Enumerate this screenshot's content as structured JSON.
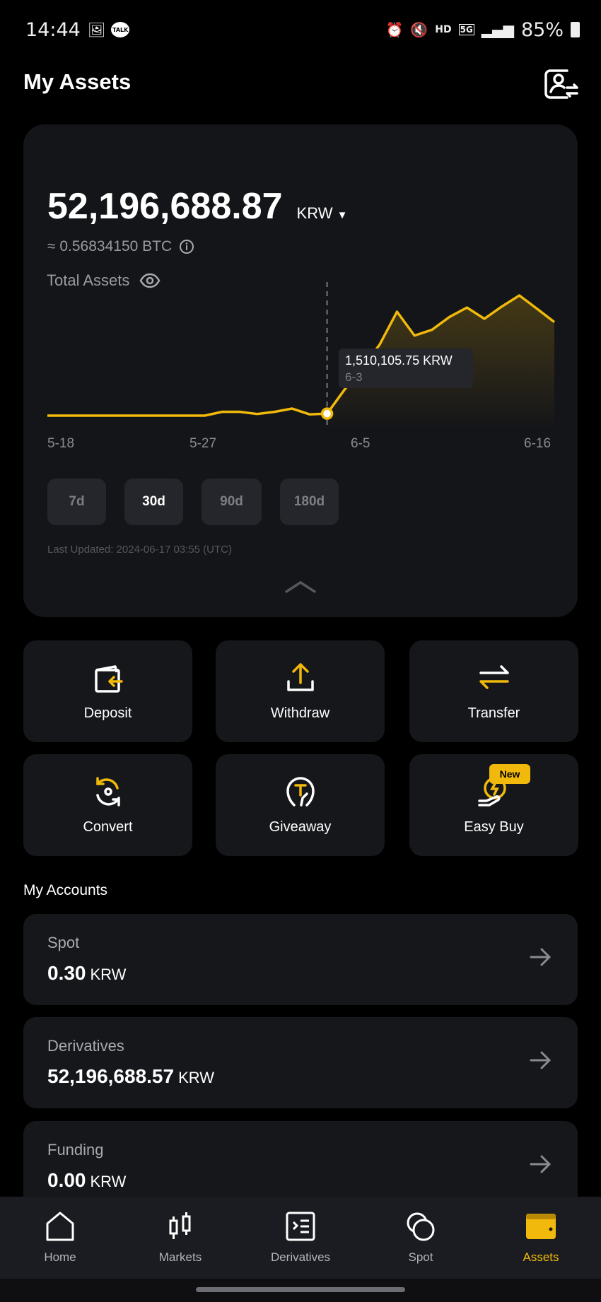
{
  "status_bar": {
    "time": "14:44",
    "battery": "85%",
    "icons": [
      "gallery-icon",
      "kakaotalk-icon",
      "alarm-icon",
      "mute-icon",
      "hd-voice-icon",
      "5g-icon",
      "signal-icon",
      "battery-icon"
    ],
    "hd": "HD",
    "fiveg": "5G",
    "talk": "TALK"
  },
  "header": {
    "title": "My Assets",
    "action_icon": "account-switch-icon"
  },
  "total": {
    "label": "Total Assets",
    "amount": "52,196,688.87",
    "currency": "KRW",
    "btc": "≈ 0.56834150 BTC"
  },
  "chart_data": {
    "type": "area",
    "x": [
      "5-18",
      "5-19",
      "5-20",
      "5-21",
      "5-22",
      "5-23",
      "5-24",
      "5-25",
      "5-26",
      "5-27",
      "5-28",
      "5-29",
      "5-30",
      "5-31",
      "6-1",
      "6-2",
      "6-3",
      "6-4",
      "6-5",
      "6-6",
      "6-7",
      "6-8",
      "6-9",
      "6-10",
      "6-11",
      "6-12",
      "6-13",
      "6-14",
      "6-15",
      "6-16"
    ],
    "values": [
      0.4,
      0.4,
      0.4,
      0.4,
      0.4,
      0.4,
      0.4,
      0.4,
      0.4,
      0.4,
      2.5,
      2.5,
      1.3,
      2.5,
      4.3,
      1.1,
      1.51,
      14.8,
      26.7,
      39.6,
      57.9,
      44.7,
      47.9,
      55.0,
      60.2,
      54.0,
      60.8,
      66.9,
      59.6,
      52.2
    ],
    "unit": "million KRW (estimated)",
    "x_tick_labels": [
      "5-18",
      "5-27",
      "6-5",
      "6-16"
    ],
    "tooltip": {
      "value": "1,510,105.75 KRW",
      "date": "6-3",
      "index": 16
    },
    "color": "#f0b90b",
    "grid": false
  },
  "ranges": [
    {
      "label": "7d",
      "active": false
    },
    {
      "label": "30d",
      "active": true
    },
    {
      "label": "90d",
      "active": false
    },
    {
      "label": "180d",
      "active": false
    }
  ],
  "last_updated": "Last Updated: 2024-06-17 03:55 (UTC)",
  "actions": [
    {
      "label": "Deposit",
      "icon": "deposit-icon"
    },
    {
      "label": "Withdraw",
      "icon": "withdraw-icon"
    },
    {
      "label": "Transfer",
      "icon": "transfer-icon"
    },
    {
      "label": "Convert",
      "icon": "convert-icon"
    },
    {
      "label": "Giveaway",
      "icon": "giveaway-icon"
    },
    {
      "label": "Easy Buy",
      "icon": "easy-buy-icon",
      "badge": "New"
    }
  ],
  "accounts": {
    "title": "My Accounts",
    "items": [
      {
        "name": "Spot",
        "value": "0.30",
        "currency": "KRW"
      },
      {
        "name": "Derivatives",
        "value": "52,196,688.57",
        "currency": "KRW"
      },
      {
        "name": "Funding",
        "value": "0.00",
        "currency": "KRW"
      }
    ]
  },
  "nav": [
    {
      "label": "Home"
    },
    {
      "label": "Markets"
    },
    {
      "label": "Derivatives"
    },
    {
      "label": "Spot"
    },
    {
      "label": "Assets",
      "active": true
    }
  ],
  "colors": {
    "accent": "#f0b90b",
    "card": "#141519",
    "background": "#000000"
  }
}
